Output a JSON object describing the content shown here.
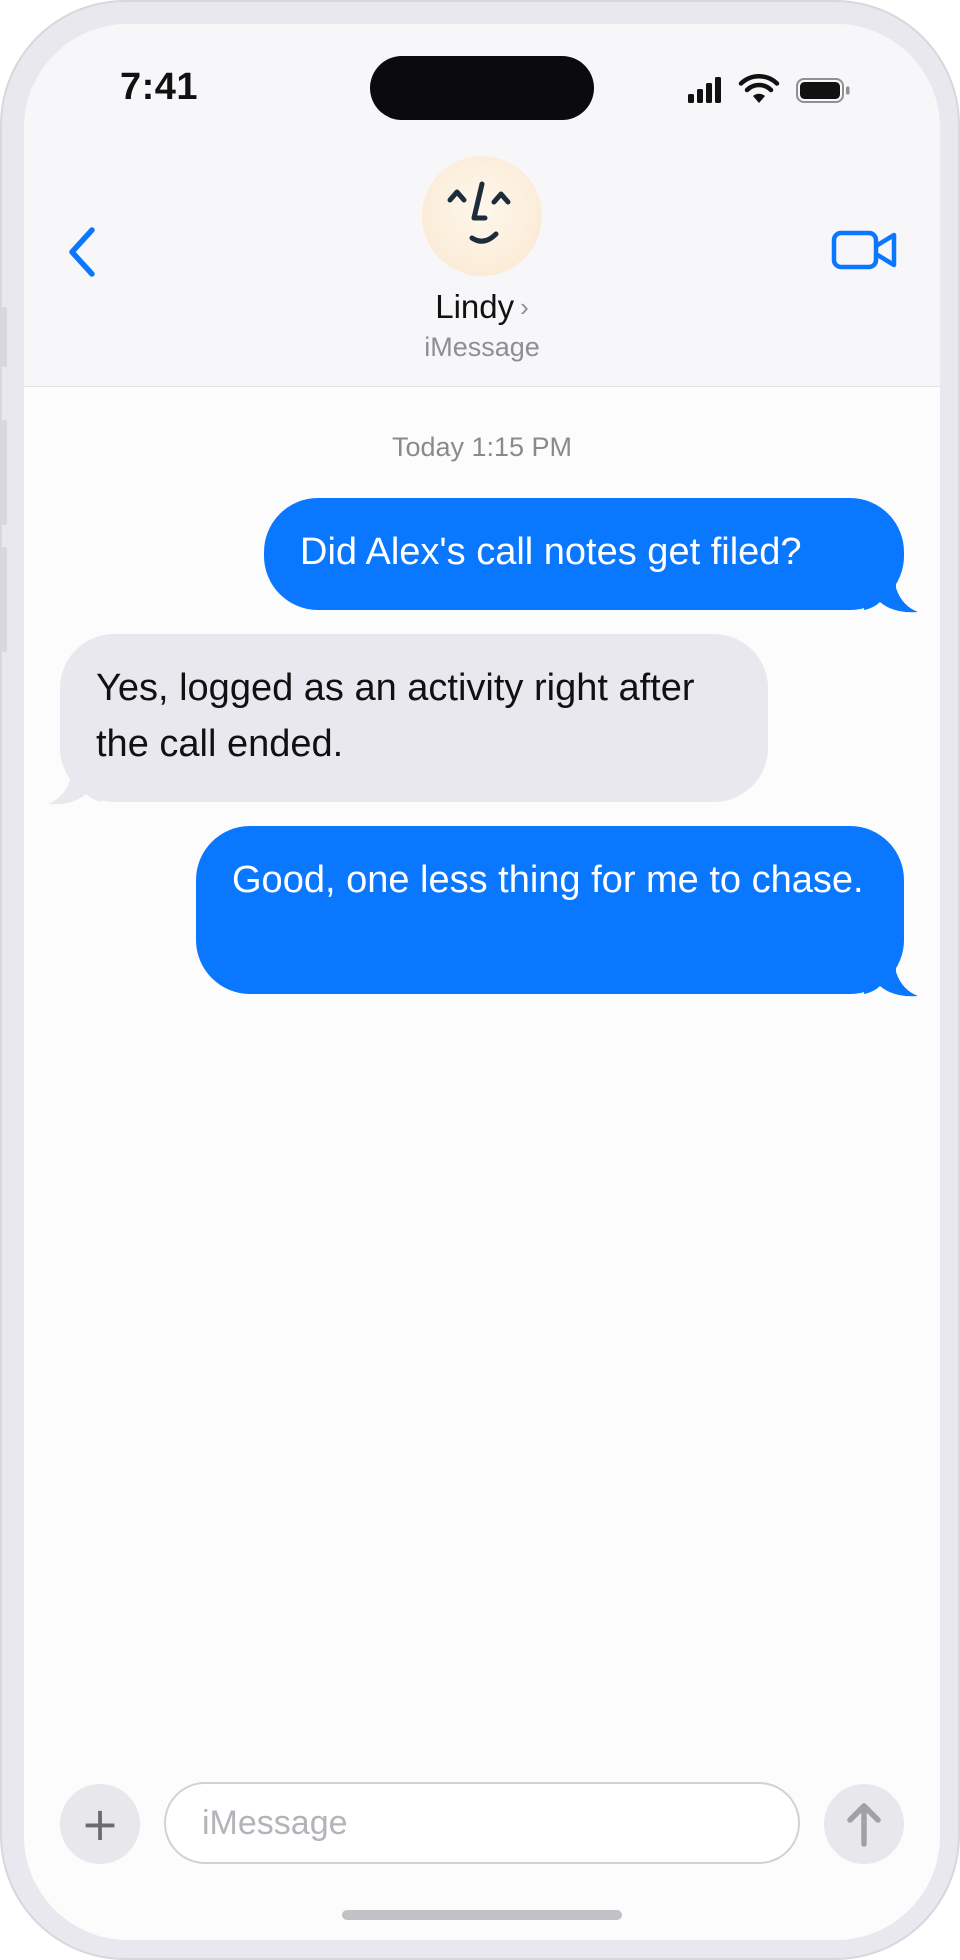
{
  "status_bar": {
    "time": "7:41"
  },
  "conversation_header": {
    "contact_name": "Lindy",
    "name_chevron": "›",
    "service": "iMessage",
    "back_icon": "chevron-left-icon",
    "video_icon": "video-camera-icon",
    "avatar_icon": "lindy-face-icon"
  },
  "thread": {
    "timestamp": "Today 1:15 PM",
    "messages": [
      {
        "direction": "outgoing",
        "text": "Did Alex's call notes get filed?"
      },
      {
        "direction": "incoming",
        "text": "Yes, logged as an activity right after the call ended."
      },
      {
        "direction": "outgoing",
        "text": "Good, one less thing for me to chase."
      }
    ]
  },
  "composer": {
    "plus_label": "+",
    "placeholder": "iMessage",
    "value": "",
    "send_icon": "arrow-up-icon"
  },
  "colors": {
    "accent": "#0a78fe",
    "incoming_bubble": "#e9e8ee",
    "header_background": "#f7f6f9"
  }
}
